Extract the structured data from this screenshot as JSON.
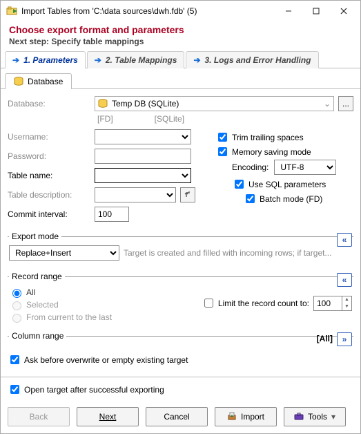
{
  "window": {
    "title": "Import Tables from 'C:\\data sources\\dwh.fdb' (5)"
  },
  "header": {
    "title": "Choose export format and parameters",
    "subtitle": "Next step: Specify table mappings"
  },
  "wizardTabs": {
    "t1": "1. Parameters",
    "t2": "2. Table Mappings",
    "t3": "3. Logs and Error Handling"
  },
  "subtab": {
    "database": "Database"
  },
  "labels": {
    "database": "Database:",
    "username": "Username:",
    "password": "Password:",
    "tablename": "Table name:",
    "tabledesc": "Table description:",
    "commit": "Commit interval:",
    "exportmode": "Export mode",
    "recordrange": "Record range",
    "columnrange": "Column range",
    "encoding": "Encoding:"
  },
  "values": {
    "database": "Temp DB (SQLite)",
    "hint_fd": "[FD]",
    "hint_sqlite": "[SQLite]",
    "username": "",
    "password": "",
    "tablename": "",
    "tabledesc": "",
    "commit": "100",
    "encoding": "UTF-8",
    "exportmode": "Replace+Insert",
    "exportmode_desc": "Target is created and filled with incoming rows; if target...",
    "recordlimit": "100",
    "columnrange_all": "[All]"
  },
  "checks": {
    "trim": "Trim trailing spaces",
    "memsave": "Memory saving mode",
    "usesql": "Use SQL parameters",
    "batch": "Batch mode (FD)",
    "limit": "Limit the record count to:",
    "askoverwrite": "Ask before overwrite or empty existing target",
    "opentarget": "Open target after successful exporting"
  },
  "radios": {
    "all": "All",
    "selected": "Selected",
    "fromcurrent": "From current to the last"
  },
  "buttons": {
    "back": "Back",
    "next": "Next",
    "cancel": "Cancel",
    "import": "Import",
    "tools": "Tools",
    "ellipsis": "..."
  }
}
